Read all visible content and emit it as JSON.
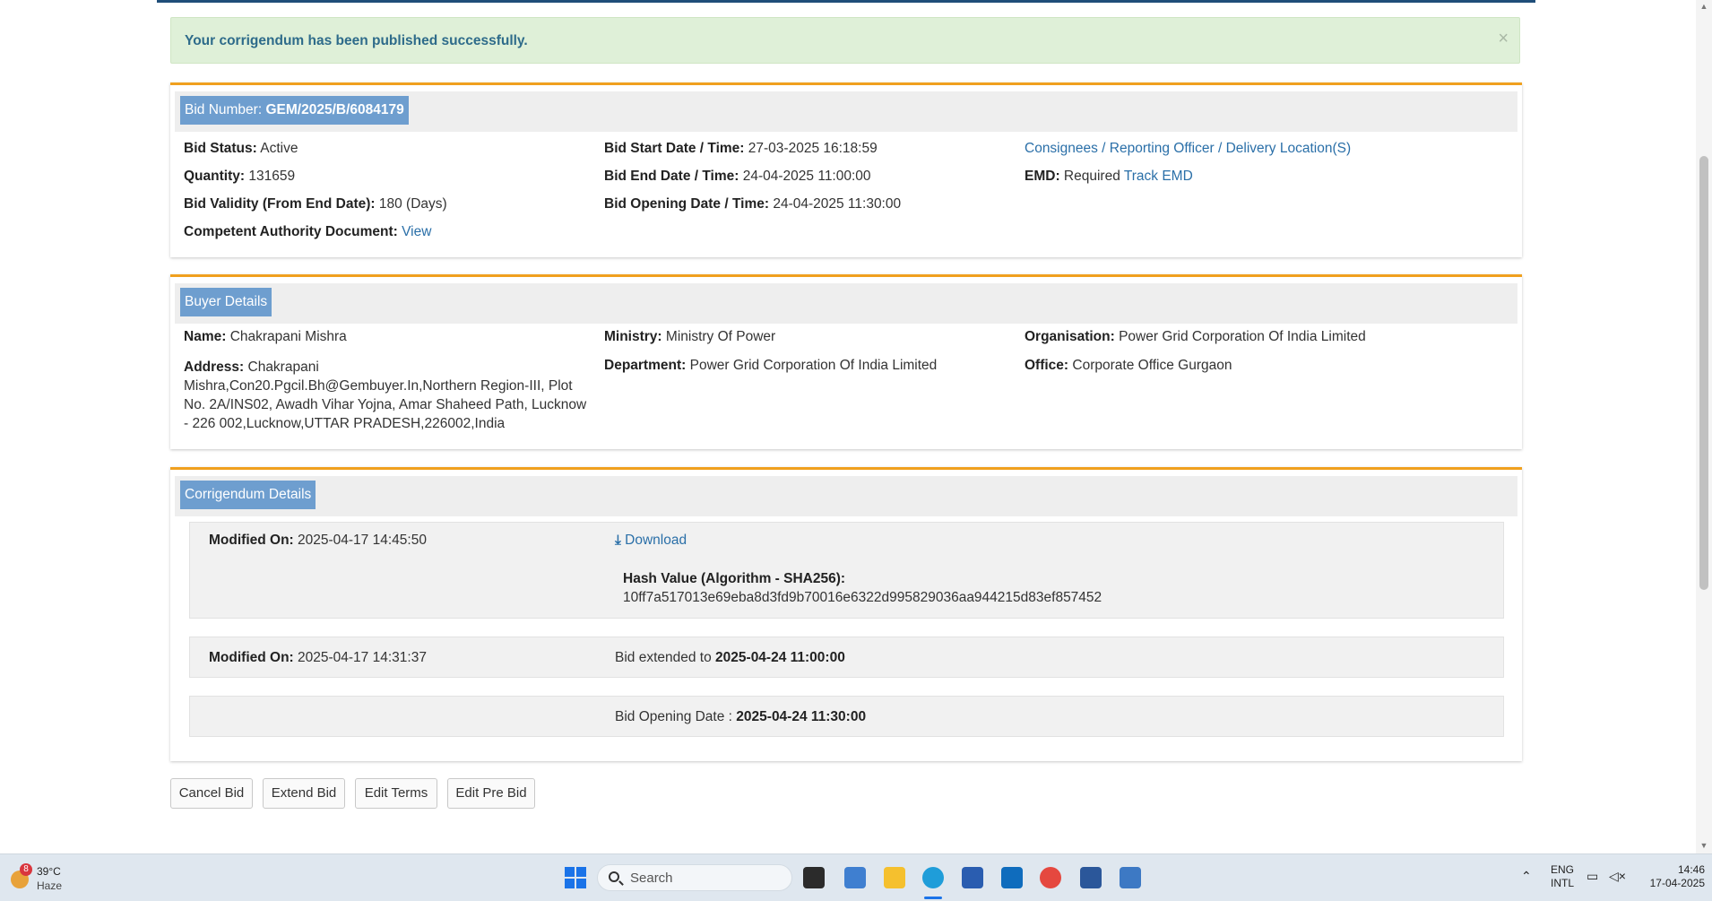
{
  "alert": {
    "message": "Your corrigendum has been published successfully.",
    "close_symbol": "×"
  },
  "bid": {
    "number_label": "Bid Number:",
    "number": "GEM/2025/B/6084179",
    "status_label": "Bid Status:",
    "status": "Active",
    "quantity_label": "Quantity:",
    "quantity": "131659",
    "validity_label": "Bid Validity (From End Date):",
    "validity": "180 (Days)",
    "cad_label": "Competent Authority Document:",
    "cad_link": "View",
    "start_label": "Bid Start Date / Time:",
    "start": "27-03-2025 16:18:59",
    "end_label": "Bid End Date / Time:",
    "end": "24-04-2025 11:00:00",
    "opening_label": "Bid Opening Date / Time:",
    "opening": "24-04-2025 11:30:00",
    "consignees_link": "Consignees / Reporting Officer / Delivery Location(S)",
    "emd_label": "EMD:",
    "emd": "Required",
    "emd_link": "Track EMD"
  },
  "buyer": {
    "heading": "Buyer Details",
    "name_label": "Name:",
    "name": "Chakrapani Mishra",
    "address_label": "Address:",
    "address": "Chakrapani Mishra,Con20.Pgcil.Bh@Gembuyer.In,Northern Region-III, Plot No. 2A/INS02, Awadh Vihar Yojna, Amar Shaheed Path, Lucknow - 226 002,Lucknow,UTTAR PRADESH,226002,India",
    "ministry_label": "Ministry:",
    "ministry": "Ministry Of Power",
    "department_label": "Department:",
    "department": "Power Grid Corporation Of India Limited",
    "organisation_label": "Organisation:",
    "organisation": "Power Grid Corporation Of India Limited",
    "office_label": "Office:",
    "office": "Corporate Office Gurgaon"
  },
  "corrigendum": {
    "heading": "Corrigendum Details",
    "row1": {
      "modified_label": "Modified On:",
      "modified": "2025-04-17 14:45:50",
      "download": "Download",
      "hash_label": "Hash Value (Algorithm - SHA256):",
      "hash": "10ff7a517013e69eba8d3fd9b70016e6322d995829036aa944215d83ef857452"
    },
    "row2": {
      "modified_label": "Modified On:",
      "modified": "2025-04-17 14:31:37",
      "text": "Bid extended to",
      "value": "2025-04-24 11:00:00"
    },
    "row3": {
      "text": "Bid Opening Date :",
      "value": "2025-04-24 11:30:00"
    }
  },
  "actions": {
    "cancel": "Cancel Bid",
    "extend": "Extend Bid",
    "terms": "Edit Terms",
    "prebid": "Edit Pre Bid"
  },
  "taskbar": {
    "weather_temp": "39°C",
    "weather_desc": "Haze",
    "weather_badge": "8",
    "search_placeholder": "Search",
    "lang": "ENG",
    "layout": "INTL",
    "time": "14:46",
    "date": "17-04-2025"
  },
  "colors": {
    "accent_orange": "#f0a01e",
    "tag_blue": "#6e9ecf",
    "link": "#2a6fa8",
    "alert_bg": "#dff0d8"
  }
}
